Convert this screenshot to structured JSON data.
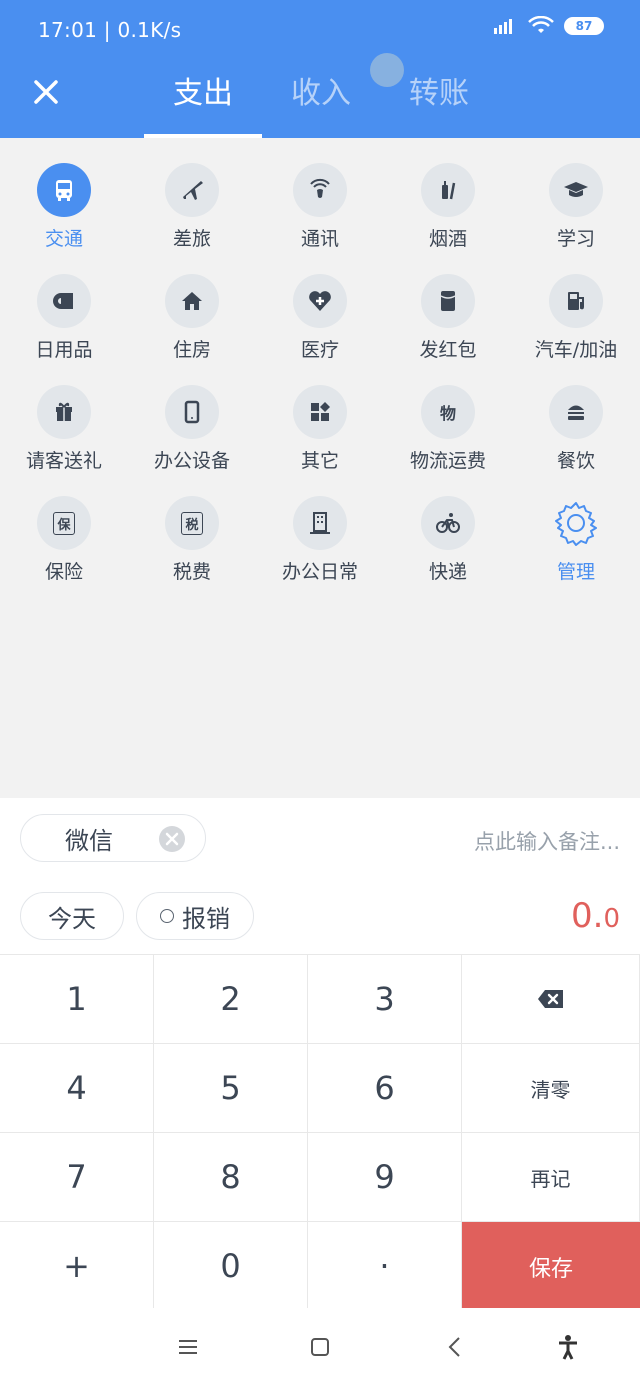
{
  "status_bar": {
    "time": "17:01 | 0.1K/s",
    "battery": "87"
  },
  "tabs": [
    {
      "label": "支出",
      "active": true
    },
    {
      "label": "收入",
      "active": false
    },
    {
      "label": "转账",
      "active": false
    }
  ],
  "categories": [
    {
      "label": "交通",
      "icon": "bus-icon",
      "active": true
    },
    {
      "label": "差旅",
      "icon": "airplane-icon"
    },
    {
      "label": "通讯",
      "icon": "phone-signal-icon"
    },
    {
      "label": "烟酒",
      "icon": "bottle-icon"
    },
    {
      "label": "学习",
      "icon": "graduation-cap-icon"
    },
    {
      "label": "日用品",
      "icon": "tissue-roll-icon"
    },
    {
      "label": "住房",
      "icon": "house-icon"
    },
    {
      "label": "医疗",
      "icon": "heart-cross-icon"
    },
    {
      "label": "发红包",
      "icon": "red-envelope-icon"
    },
    {
      "label": "汽车/加油",
      "icon": "gas-pump-icon"
    },
    {
      "label": "请客送礼",
      "icon": "gift-icon"
    },
    {
      "label": "办公设备",
      "icon": "mobile-device-icon"
    },
    {
      "label": "其它",
      "icon": "grid-shapes-icon"
    },
    {
      "label": "物流运费",
      "icon": "logistics-icon",
      "glyph": "物"
    },
    {
      "label": "餐饮",
      "icon": "burger-icon"
    },
    {
      "label": "保险",
      "icon": "insurance-shield-icon",
      "glyph": "保"
    },
    {
      "label": "税费",
      "icon": "tax-card-icon",
      "glyph": "税"
    },
    {
      "label": "办公日常",
      "icon": "office-building-icon"
    },
    {
      "label": "快递",
      "icon": "bicycle-icon"
    },
    {
      "label": "管理",
      "icon": "gear-icon",
      "manage": true
    }
  ],
  "input": {
    "wallet": "微信",
    "note_placeholder": "点此输入备注...",
    "date": "今天",
    "reimburse": "报销",
    "amount_int": "0.",
    "amount_dec": "0"
  },
  "keypad": {
    "k1": "1",
    "k2": "2",
    "k3": "3",
    "k4": "4",
    "k5": "5",
    "k6": "6",
    "k7": "7",
    "k8": "8",
    "k9": "9",
    "plus": "+",
    "k0": "0",
    "dot": "·",
    "clear": "清零",
    "again": "再记",
    "save": "保存"
  },
  "colors": {
    "accent": "#4a8ff0",
    "save": "#e0605c"
  }
}
